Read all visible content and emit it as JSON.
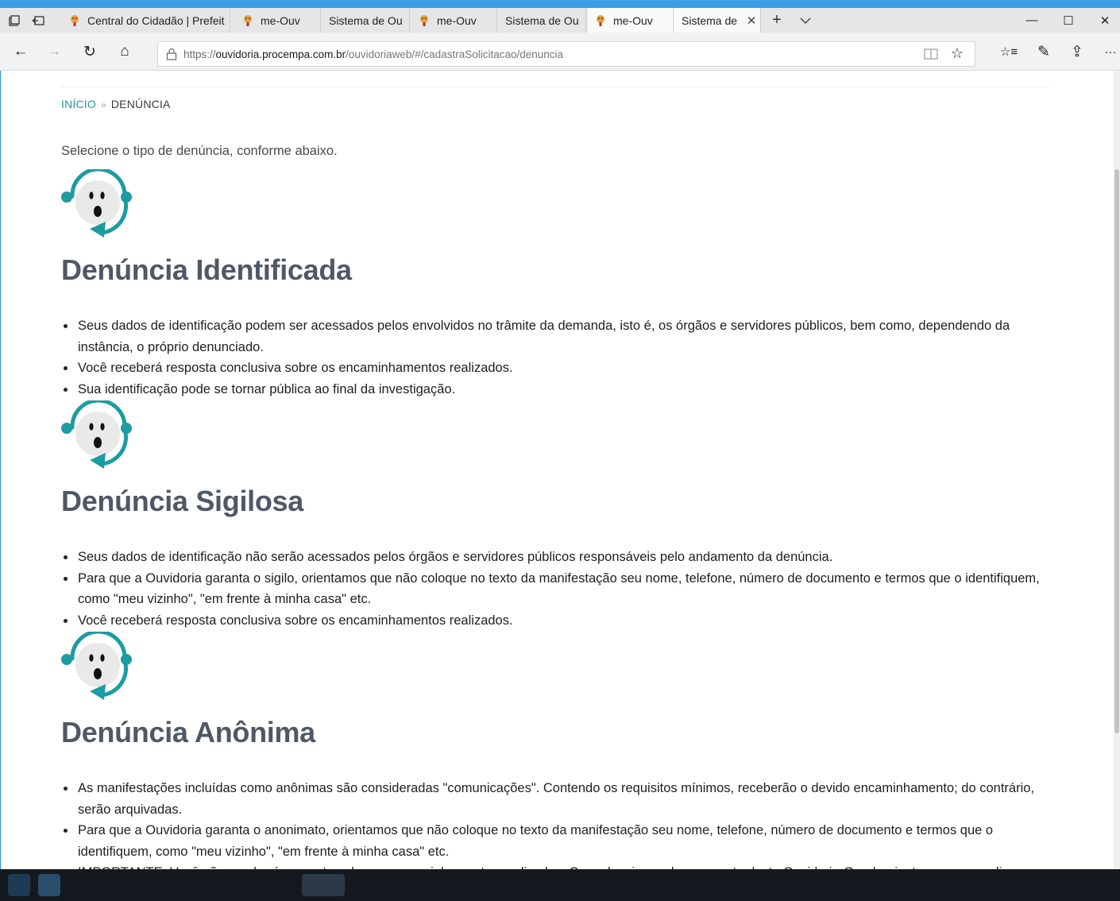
{
  "browser": {
    "tabs": [
      {
        "label": "Central do Cidadão | Prefeit",
        "favicon": true
      },
      {
        "label": "me-Ouv",
        "favicon": true
      },
      {
        "label": "Sistema de Ou",
        "favicon": false
      },
      {
        "label": "me-Ouv",
        "favicon": true
      },
      {
        "label": "Sistema de Ou",
        "favicon": false
      },
      {
        "label": "me-Ouv",
        "favicon": true,
        "active": true
      },
      {
        "label": "Sistema de",
        "favicon": false,
        "active": true,
        "closable": true
      }
    ],
    "url": {
      "scheme": "https://",
      "host": "ouvidoria.procempa.com.br",
      "path": "/ouvidoriaweb/#/cadastraSolicitacao/denuncia"
    },
    "icons": {
      "tab_preview": "tab-preview-icon",
      "tab_aside": "tabs-aside-icon",
      "new_tab": "+",
      "tab_list": "chevron-down-icon",
      "minimize": "—",
      "maximize": "☐",
      "close": "✕",
      "back": "←",
      "forward": "→",
      "refresh": "↻",
      "home": "⌂",
      "star": "☆",
      "favorites": "☆≡",
      "notes": "✎",
      "share": "⇪",
      "more": "···"
    },
    "accent": "#2b8dd8"
  },
  "page": {
    "breadcrumb": {
      "home": "INÍCIO",
      "separator": "»",
      "current": "DENÚNCIA"
    },
    "intro": "Selecione o tipo de denúncia, conforme abaixo.",
    "sections": [
      {
        "title": "Denúncia Identificada",
        "items": [
          "Seus dados de identificação podem ser acessados pelos envolvidos no trâmite da demanda, isto é, os órgãos e servidores públicos, bem como, dependendo da instância, o próprio denunciado.",
          "Você receberá resposta conclusiva sobre os encaminhamentos realizados.",
          "Sua identificação pode se tornar pública ao final da investigação."
        ]
      },
      {
        "title": "Denúncia Sigilosa",
        "items": [
          "Seus dados de identificação não serão acessados pelos órgãos e servidores públicos responsáveis pelo andamento da denúncia.",
          "Para que a Ouvidoria garanta o sigilo, orientamos que não coloque no texto da manifestação seu nome, telefone, número de documento e termos que o identifiquem, como \"meu vizinho\", \"em frente à minha casa\" etc.",
          "Você receberá resposta conclusiva sobre os encaminhamentos realizados."
        ]
      },
      {
        "title": "Denúncia Anônima",
        "items": [
          "As manifestações incluídas como anônimas são consideradas \"comunicações\". Contendo os requisitos mínimos, receberão o devido encaminhamento; do contrário, serão arquivadas.",
          "Para que a Ouvidoria garanta o anonimato, orientamos que não coloque no texto da manifestação seu nome, telefone, número de documento e termos que o identifiquem, como \"meu vizinho\", \"em frente à minha casa\" etc.",
          "IMPORTANTE: Você não receberá resposta sobre os encaminhamentos realizados. Caso deseje receber resposta desta Ouvidoria-Geral, orientamos que realize nova manifestação de forma identificada ou sigilosa."
        ]
      }
    ],
    "colors": {
      "teal": "#1d9ba3",
      "heading": "#505866"
    }
  }
}
